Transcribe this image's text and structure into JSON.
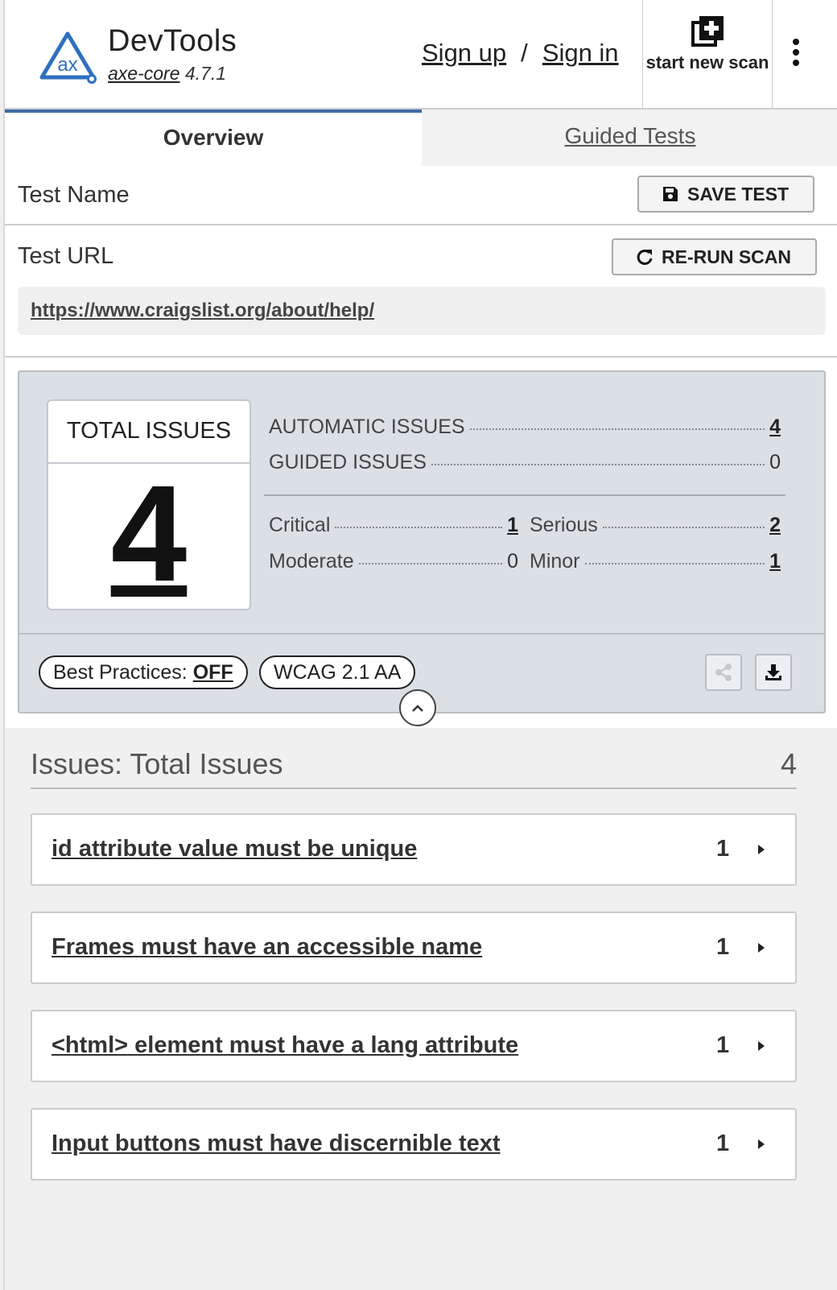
{
  "header": {
    "title": "DevTools",
    "engine_link": "axe-core",
    "engine_version": "4.7.1",
    "sign_up": "Sign up",
    "separator": "/",
    "sign_in": "Sign in",
    "start_new_scan": "start new scan",
    "logo_text": "ax",
    "icons": {
      "logo": "axe-logo-icon",
      "new_scan": "add-box-icon",
      "menu": "kebab-menu-icon"
    }
  },
  "tabs": [
    {
      "label": "Overview",
      "active": true
    },
    {
      "label": "Guided Tests",
      "active": false
    }
  ],
  "test_name": {
    "label": "Test Name",
    "save_button": "SAVE TEST"
  },
  "test_url": {
    "label": "Test URL",
    "rerun_button": "RE-RUN SCAN",
    "url": "https://www.craigslist.org/about/help/"
  },
  "summary": {
    "total_label": "TOTAL ISSUES",
    "total_value": "4",
    "automatic_label": "AUTOMATIC ISSUES",
    "automatic_value": "4",
    "guided_label": "GUIDED ISSUES",
    "guided_value": "0",
    "critical_label": "Critical",
    "critical_value": "1",
    "serious_label": "Serious",
    "serious_value": "2",
    "moderate_label": "Moderate",
    "moderate_value": "0",
    "minor_label": "Minor",
    "minor_value": "1",
    "best_practices_label": "Best Practices:",
    "best_practices_value": "OFF",
    "standard": "WCAG 2.1 AA"
  },
  "issues": {
    "heading": "Issues: Total Issues",
    "count": "4",
    "items": [
      {
        "name": "id attribute value must be unique",
        "count": "1"
      },
      {
        "name": "Frames must have an accessible name",
        "count": "1"
      },
      {
        "name": "<html> element must have a lang attribute",
        "count": "1"
      },
      {
        "name": "Input buttons must have discernible text",
        "count": "1"
      }
    ]
  },
  "colors": {
    "accent": "#3d6ca2",
    "logo": "#2f6fc0",
    "summary_bg": "#dbe0e5"
  }
}
